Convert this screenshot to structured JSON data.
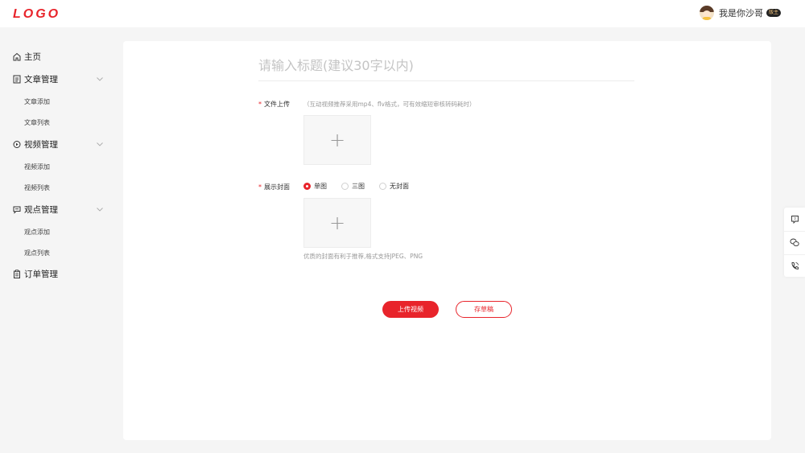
{
  "header": {
    "logo": "LOGO",
    "user_name": "我是你沙哥",
    "badge": "版主"
  },
  "sidebar": {
    "home": "主页",
    "groups": [
      {
        "label": "文章管理",
        "icon": "document-icon",
        "children": [
          "文章添加",
          "文章列表"
        ]
      },
      {
        "label": "视频管理",
        "icon": "video-icon",
        "children": [
          "视频添加",
          "视频列表"
        ]
      },
      {
        "label": "观点管理",
        "icon": "comment-icon",
        "children": [
          "观点添加",
          "观点列表"
        ]
      }
    ],
    "orders": "订单管理"
  },
  "form": {
    "title_placeholder": "请输入标题(建议30字以内)",
    "file_label": "文件上传",
    "file_hint": "（互动视频推荐采用mp4、flv格式，可有效缩短审核转码耗时）",
    "cover_label": "展示封面",
    "cover_options": [
      "单图",
      "三图",
      "无封面"
    ],
    "cover_selected": "单图",
    "cover_hint": "优质的封面有利于推荐,格式支持JPEG、PNG",
    "plus": "+"
  },
  "actions": {
    "upload": "上传视频",
    "draft": "存草稿"
  },
  "colors": {
    "accent": "#e8242b",
    "background": "#f5f5f5"
  },
  "float_tools": [
    "feedback-icon",
    "wechat-icon",
    "phone-icon"
  ]
}
